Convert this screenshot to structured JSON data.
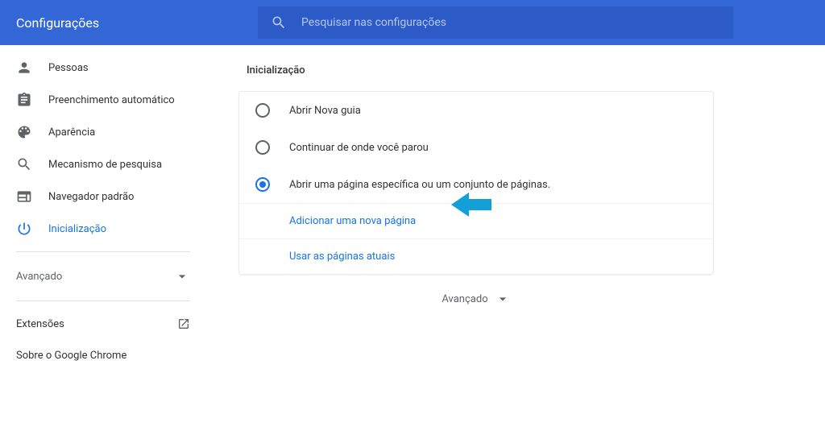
{
  "header": {
    "title": "Configurações",
    "search_placeholder": "Pesquisar nas configurações"
  },
  "sidebar": {
    "items": [
      {
        "label": "Pessoas",
        "icon": "person"
      },
      {
        "label": "Preenchimento automático",
        "icon": "assignment"
      },
      {
        "label": "Aparência",
        "icon": "palette"
      },
      {
        "label": "Mecanismo de pesquisa",
        "icon": "search"
      },
      {
        "label": "Navegador padrão",
        "icon": "web"
      },
      {
        "label": "Inicialização",
        "icon": "power"
      }
    ],
    "advanced_label": "Avançado",
    "extensions_label": "Extensões",
    "about_label": "Sobre o Google Chrome"
  },
  "main": {
    "section_title": "Inicialização",
    "options": [
      "Abrir Nova guia",
      "Continuar de onde você parou",
      "Abrir uma página específica ou um conjunto de páginas."
    ],
    "add_page_label": "Adicionar uma nova página",
    "use_current_label": "Usar as páginas atuais",
    "footer_advanced_label": "Avançado"
  }
}
